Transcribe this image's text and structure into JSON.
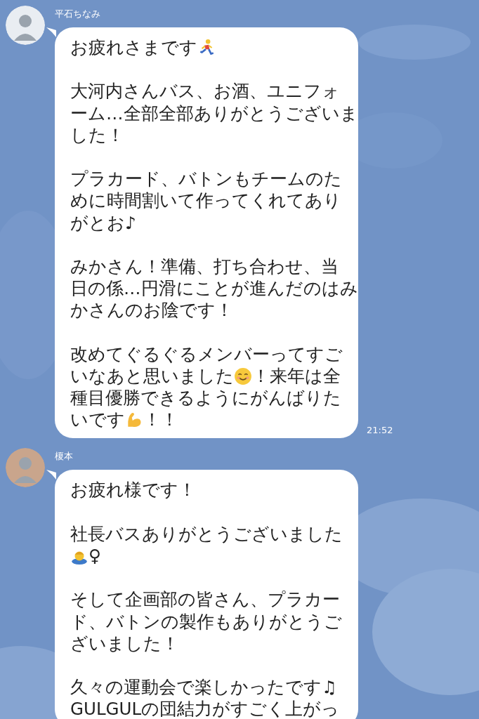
{
  "messages": [
    {
      "sender": "平石ちなみ",
      "time": "21:52",
      "paragraphs": [
        [
          [
            {
              "kind": "text",
              "text": "お疲れさまです"
            },
            {
              "kind": "runner"
            }
          ]
        ],
        [
          [
            {
              "kind": "text",
              "text": "大河内さんバス、お酒、ユニフォ"
            }
          ],
          [
            {
              "kind": "text",
              "text": "ーム…全部全部ありがとうございま"
            }
          ],
          [
            {
              "kind": "text",
              "text": "した！"
            }
          ]
        ],
        [
          [
            {
              "kind": "text",
              "text": "プラカード、バトンもチームのた"
            }
          ],
          [
            {
              "kind": "text",
              "text": "めに時間割いて作ってくれてあり"
            }
          ],
          [
            {
              "kind": "text",
              "text": "がとお♪"
            }
          ]
        ],
        [
          [
            {
              "kind": "text",
              "text": "みかさん！準備、打ち合わせ、当"
            }
          ],
          [
            {
              "kind": "text",
              "text": "日の係…円滑にことが進んだのはみ"
            }
          ],
          [
            {
              "kind": "text",
              "text": "かさんのお陰です！"
            }
          ]
        ],
        [
          [
            {
              "kind": "text",
              "text": "改めてぐるぐるメンバーってすご"
            }
          ],
          [
            {
              "kind": "text",
              "text": "いなあと思いました"
            },
            {
              "kind": "smile"
            },
            {
              "kind": "text",
              "text": "！来年は全"
            }
          ],
          [
            {
              "kind": "text",
              "text": "種目優勝できるようにがんばりた"
            }
          ],
          [
            {
              "kind": "text",
              "text": "いです"
            },
            {
              "kind": "flex"
            },
            {
              "kind": "text",
              "text": "！！"
            }
          ]
        ]
      ]
    },
    {
      "sender": "榎本",
      "paragraphs": [
        [
          [
            {
              "kind": "text",
              "text": "お疲れ様です！"
            }
          ]
        ],
        [
          [
            {
              "kind": "text",
              "text": "社長バスありがとうございました"
            }
          ],
          [
            {
              "kind": "bow"
            },
            {
              "kind": "text",
              "text": "♀"
            }
          ]
        ],
        [
          [
            {
              "kind": "text",
              "text": "そして企画部の皆さん、プラカー"
            }
          ],
          [
            {
              "kind": "text",
              "text": "ド、バトンの製作もありがとうご"
            }
          ],
          [
            {
              "kind": "text",
              "text": "ざいました！"
            }
          ]
        ],
        [
          [
            {
              "kind": "text",
              "text": "久々の運動会で楽しかったです♫"
            }
          ],
          [
            {
              "kind": "text",
              "text": "GULGULの団結力がすごく上がっ"
            }
          ]
        ]
      ]
    }
  ]
}
